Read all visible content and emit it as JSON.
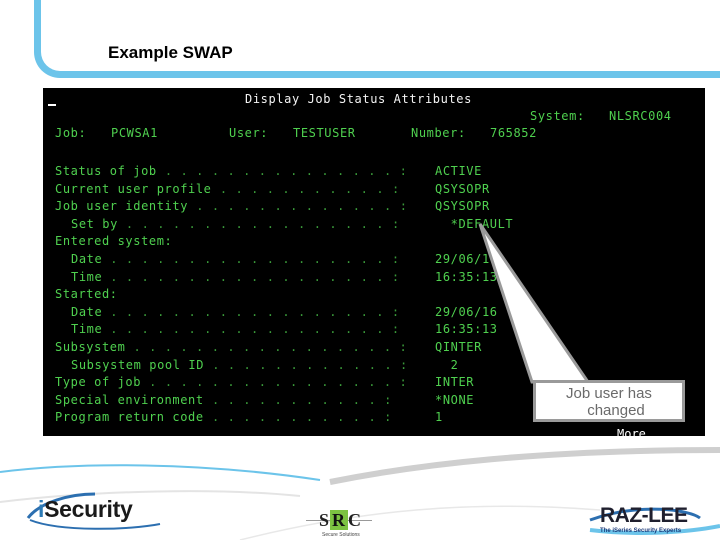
{
  "slide": {
    "title": "Example SWAP"
  },
  "terminal": {
    "screen_title": "Display Job Status Attributes",
    "system_label": "System:",
    "system_value": "NLSRC004",
    "job_label": "Job:",
    "job_value": "PCWSA1",
    "user_label": "User:",
    "user_value": "TESTUSER",
    "number_label": "Number:",
    "number_value": "765852",
    "rows": [
      {
        "label": "Status of job",
        "indent": false,
        "dots": " . . . . . . . . . . . . . . . :",
        "value": "ACTIVE"
      },
      {
        "label": "Current user profile",
        "indent": false,
        "dots": " . . . . . . . . . . . :",
        "value": "QSYSOPR"
      },
      {
        "label": "Job user identity",
        "indent": false,
        "dots": " . . . . . . . . . . . . . :",
        "value": "QSYSOPR"
      },
      {
        "label": "Set by",
        "indent": true,
        "dots": " . . . . . . . . . . . . . . . . . :",
        "value": "  *DEFAULT"
      },
      {
        "label": "Entered system:",
        "indent": false,
        "dots": "",
        "value": ""
      },
      {
        "label": "Date",
        "indent": true,
        "dots": " . . . . . . . . . . . . . . . . . . :",
        "value": "29/06/16"
      },
      {
        "label": "Time",
        "indent": true,
        "dots": " . . . . . . . . . . . . . . . . . . :",
        "value": "16:35:13"
      },
      {
        "label": "Started:",
        "indent": false,
        "dots": "",
        "value": ""
      },
      {
        "label": "Date",
        "indent": true,
        "dots": " . . . . . . . . . . . . . . . . . . :",
        "value": "29/06/16"
      },
      {
        "label": "Time",
        "indent": true,
        "dots": " . . . . . . . . . . . . . . . . . . :",
        "value": "16:35:13"
      },
      {
        "label": "Subsystem",
        "indent": false,
        "dots": " . . . . . . . . . . . . . . . . . :",
        "value": "QINTER"
      },
      {
        "label": "Subsystem pool ID",
        "indent": true,
        "dots": " . . . . . . . . . . . . :",
        "value": "  2"
      },
      {
        "label": "Type of job",
        "indent": false,
        "dots": " . . . . . . . . . . . . . . . . :",
        "value": "INTER"
      },
      {
        "label": "Special environment",
        "indent": false,
        "dots": " . . . . . . . . . . . :",
        "value": "*NONE"
      },
      {
        "label": "Program return code",
        "indent": false,
        "dots": " . . . . . . . . . . . :",
        "value": "1"
      }
    ],
    "more_label": "More..."
  },
  "callout": {
    "line1": "Job user has",
    "line2": "changed"
  },
  "footer": {
    "isecurity_i": "i",
    "isecurity_rest": "Security",
    "src_s": "S",
    "src_r": "R",
    "src_c": "C",
    "src_tagline": "Secure Solutions",
    "razlee_name": "RAZ-LEE",
    "razlee_tagline": "The iSeries Security Experts"
  },
  "colors": {
    "accent_blue": "#6cc4ea",
    "terminal_green": "#4fd04f",
    "terminal_bg": "#000000"
  }
}
